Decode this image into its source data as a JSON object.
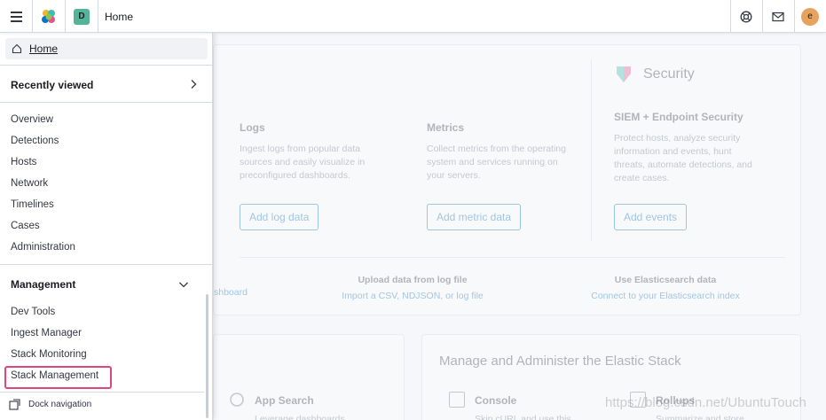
{
  "header": {
    "breadcrumb": "Home",
    "space_initial": "D",
    "user_initial": "e"
  },
  "nav": {
    "home_label": "Home",
    "recently_viewed": "Recently viewed",
    "security_items": [
      "Overview",
      "Detections",
      "Hosts",
      "Network",
      "Timelines",
      "Cases",
      "Administration"
    ],
    "management_title": "Management",
    "management_items": [
      "Dev Tools",
      "Ingest Manager",
      "Stack Monitoring",
      "Stack Management"
    ],
    "dock_label": "Dock navigation"
  },
  "page": {
    "logs": {
      "title": "Logs",
      "desc": [
        "Ingest logs from popular data",
        "sources and easily visualize in",
        "preconfigured dashboards."
      ],
      "button": "Add log data"
    },
    "metrics": {
      "title": "Metrics",
      "desc": [
        "Collect metrics from the operating",
        "system and services running on",
        "your servers."
      ],
      "button": "Add metric data"
    },
    "security": {
      "heading": "Security",
      "title": "SIEM + Endpoint Security",
      "desc": [
        "Protect hosts, analyze security",
        "information and events, hunt",
        "threats, automate detections, and",
        "create cases."
      ],
      "button": "Add events"
    },
    "sample_fragment": "shboard",
    "upload": {
      "title": "Upload data from log file",
      "link": "Import a CSV, NDJSON, or log file"
    },
    "es": {
      "title": "Use Elasticsearch data",
      "link": "Connect to your Elasticsearch index"
    },
    "app_search": {
      "title": "App Search",
      "desc": "Leverage dashboards"
    },
    "manage": {
      "title": "Manage and Administer the Elastic Stack",
      "console": "Console",
      "console_desc": "Skip cURL and use this",
      "rollups": "Rollups",
      "rollups_desc": "Summarize and store"
    }
  },
  "watermark": "https://blog.csdn.net/UbuntuTouch",
  "colors": {
    "highlight": "#e0457b",
    "link": "#006bb8",
    "space_badge": "#54b399",
    "avatar": "#e7a35e"
  }
}
